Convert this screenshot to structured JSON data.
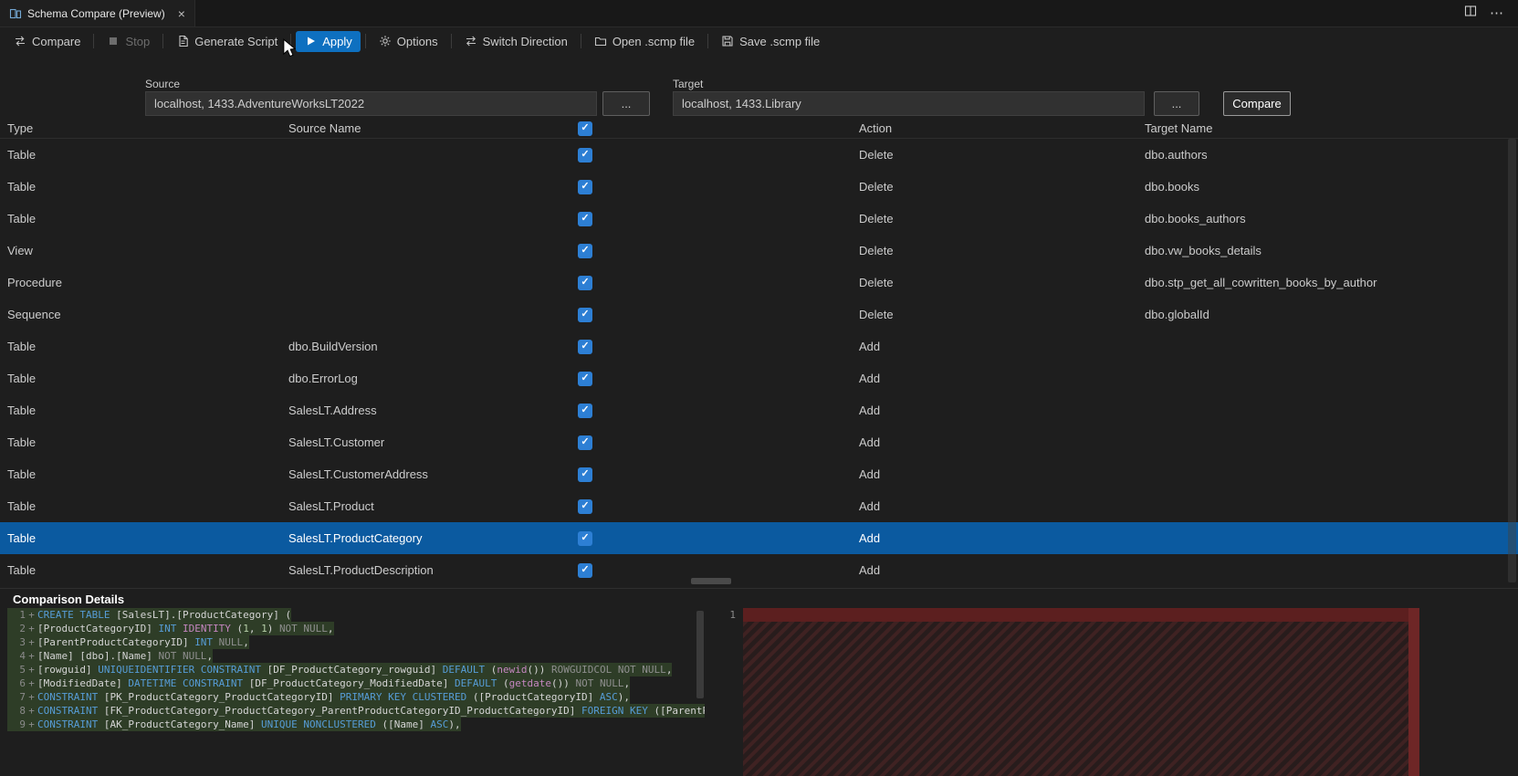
{
  "window": {
    "tab_title": "Schema Compare (Preview)"
  },
  "toolbar": {
    "items": [
      {
        "label": "Compare",
        "icon": "compare-icon",
        "disabled": false,
        "active": false
      },
      {
        "label": "Stop",
        "icon": "stop-icon",
        "disabled": true,
        "active": false
      },
      {
        "label": "Generate Script",
        "icon": "generate-script-icon",
        "disabled": false,
        "active": false
      },
      {
        "label": "Apply",
        "icon": "play-icon",
        "disabled": false,
        "active": true
      },
      {
        "label": "Options",
        "icon": "gear-icon",
        "disabled": false,
        "active": false
      },
      {
        "label": "Switch Direction",
        "icon": "switch-direction-icon",
        "disabled": false,
        "active": false
      },
      {
        "label": "Open .scmp file",
        "icon": "open-file-icon",
        "disabled": false,
        "active": false
      },
      {
        "label": "Save .scmp file",
        "icon": "save-icon",
        "disabled": false,
        "active": false
      }
    ]
  },
  "connections": {
    "source_label": "Source",
    "source_value": "localhost, 1433.AdventureWorksLT2022",
    "target_label": "Target",
    "target_value": "localhost, 1433.Library",
    "browse_label": "...",
    "compare_label": "Compare"
  },
  "grid": {
    "columns": {
      "type": "Type",
      "source": "Source Name",
      "action": "Action",
      "target": "Target Name"
    },
    "select_all_checked": true,
    "rows": [
      {
        "type": "Table",
        "source": "",
        "checked": true,
        "action": "Delete",
        "target": "dbo.authors",
        "selected": false
      },
      {
        "type": "Table",
        "source": "",
        "checked": true,
        "action": "Delete",
        "target": "dbo.books",
        "selected": false
      },
      {
        "type": "Table",
        "source": "",
        "checked": true,
        "action": "Delete",
        "target": "dbo.books_authors",
        "selected": false
      },
      {
        "type": "View",
        "source": "",
        "checked": true,
        "action": "Delete",
        "target": "dbo.vw_books_details",
        "selected": false
      },
      {
        "type": "Procedure",
        "source": "",
        "checked": true,
        "action": "Delete",
        "target": "dbo.stp_get_all_cowritten_books_by_author",
        "selected": false
      },
      {
        "type": "Sequence",
        "source": "",
        "checked": true,
        "action": "Delete",
        "target": "dbo.globalId",
        "selected": false
      },
      {
        "type": "Table",
        "source": "dbo.BuildVersion",
        "checked": true,
        "action": "Add",
        "target": "",
        "selected": false
      },
      {
        "type": "Table",
        "source": "dbo.ErrorLog",
        "checked": true,
        "action": "Add",
        "target": "",
        "selected": false
      },
      {
        "type": "Table",
        "source": "SalesLT.Address",
        "checked": true,
        "action": "Add",
        "target": "",
        "selected": false
      },
      {
        "type": "Table",
        "source": "SalesLT.Customer",
        "checked": true,
        "action": "Add",
        "target": "",
        "selected": false
      },
      {
        "type": "Table",
        "source": "SalesLT.CustomerAddress",
        "checked": true,
        "action": "Add",
        "target": "",
        "selected": false
      },
      {
        "type": "Table",
        "source": "SalesLT.Product",
        "checked": true,
        "action": "Add",
        "target": "",
        "selected": false
      },
      {
        "type": "Table",
        "source": "SalesLT.ProductCategory",
        "checked": true,
        "action": "Add",
        "target": "",
        "selected": true
      },
      {
        "type": "Table",
        "source": "SalesLT.ProductDescription",
        "checked": true,
        "action": "Add",
        "target": "",
        "selected": false
      }
    ]
  },
  "details": {
    "title": "Comparison Details",
    "left": {
      "lines": [
        {
          "num": "1",
          "sign": "+",
          "tokens": [
            [
              "kw",
              "CREATE TABLE"
            ],
            [
              "pl",
              " [SalesLT].[ProductCategory] ("
            ]
          ]
        },
        {
          "num": "2",
          "sign": "+",
          "tokens": [
            [
              "pl",
              "[ProductCategoryID] "
            ],
            [
              "kw",
              "INT"
            ],
            [
              "mg",
              " IDENTITY"
            ],
            [
              "pl",
              " ("
            ],
            [
              "nm",
              "1"
            ],
            [
              "pl",
              ", "
            ],
            [
              "nm",
              "1"
            ],
            [
              "pl",
              ") "
            ],
            [
              "dm",
              "NOT NULL"
            ],
            [
              "pl",
              ","
            ]
          ]
        },
        {
          "num": "3",
          "sign": "+",
          "tokens": [
            [
              "pl",
              "[ParentProductCategoryID] "
            ],
            [
              "kw",
              "INT"
            ],
            [
              "dm",
              " NULL"
            ],
            [
              "pl",
              ","
            ]
          ]
        },
        {
          "num": "4",
          "sign": "+",
          "tokens": [
            [
              "pl",
              "[Name] [dbo].[Name] "
            ],
            [
              "dm",
              "NOT NULL"
            ],
            [
              "pl",
              ","
            ]
          ]
        },
        {
          "num": "5",
          "sign": "+",
          "tokens": [
            [
              "pl",
              "[rowguid] "
            ],
            [
              "kw",
              "UNIQUEIDENTIFIER CONSTRAINT"
            ],
            [
              "pl",
              " [DF_ProductCategory_rowguid] "
            ],
            [
              "kw",
              "DEFAULT"
            ],
            [
              "pl",
              " ("
            ],
            [
              "mg",
              "newid"
            ],
            [
              "pl",
              "()) "
            ],
            [
              "dm",
              "ROWGUIDCOL NOT NULL"
            ],
            [
              "pl",
              ","
            ]
          ]
        },
        {
          "num": "6",
          "sign": "+",
          "tokens": [
            [
              "pl",
              "[ModifiedDate] "
            ],
            [
              "kw",
              "DATETIME CONSTRAINT"
            ],
            [
              "pl",
              " [DF_ProductCategory_ModifiedDate] "
            ],
            [
              "kw",
              "DEFAULT"
            ],
            [
              "pl",
              " ("
            ],
            [
              "mg",
              "getdate"
            ],
            [
              "pl",
              "()) "
            ],
            [
              "dm",
              "NOT NULL"
            ],
            [
              "pl",
              ","
            ]
          ]
        },
        {
          "num": "7",
          "sign": "+",
          "tokens": [
            [
              "kw",
              "CONSTRAINT"
            ],
            [
              "pl",
              " [PK_ProductCategory_ProductCategoryID] "
            ],
            [
              "kw",
              "PRIMARY KEY CLUSTERED"
            ],
            [
              "pl",
              " ([ProductCategoryID] "
            ],
            [
              "kw",
              "ASC"
            ],
            [
              "pl",
              "),"
            ]
          ]
        },
        {
          "num": "8",
          "sign": "+",
          "tokens": [
            [
              "kw",
              "CONSTRAINT"
            ],
            [
              "pl",
              " [FK_ProductCategory_ProductCategory_ParentProductCategoryID_ProductCategoryID] "
            ],
            [
              "kw",
              "FOREIGN KEY"
            ],
            [
              "pl",
              " ([ParentProductCatego"
            ]
          ]
        },
        {
          "num": "9",
          "sign": "+",
          "tokens": [
            [
              "kw",
              "CONSTRAINT"
            ],
            [
              "pl",
              " [AK_ProductCategory_Name] "
            ],
            [
              "kw",
              "UNIQUE NONCLUSTERED"
            ],
            [
              "pl",
              " ([Name] "
            ],
            [
              "kw",
              "ASC"
            ],
            [
              "pl",
              "),"
            ]
          ]
        }
      ]
    },
    "right": {
      "line_num": "1"
    }
  }
}
